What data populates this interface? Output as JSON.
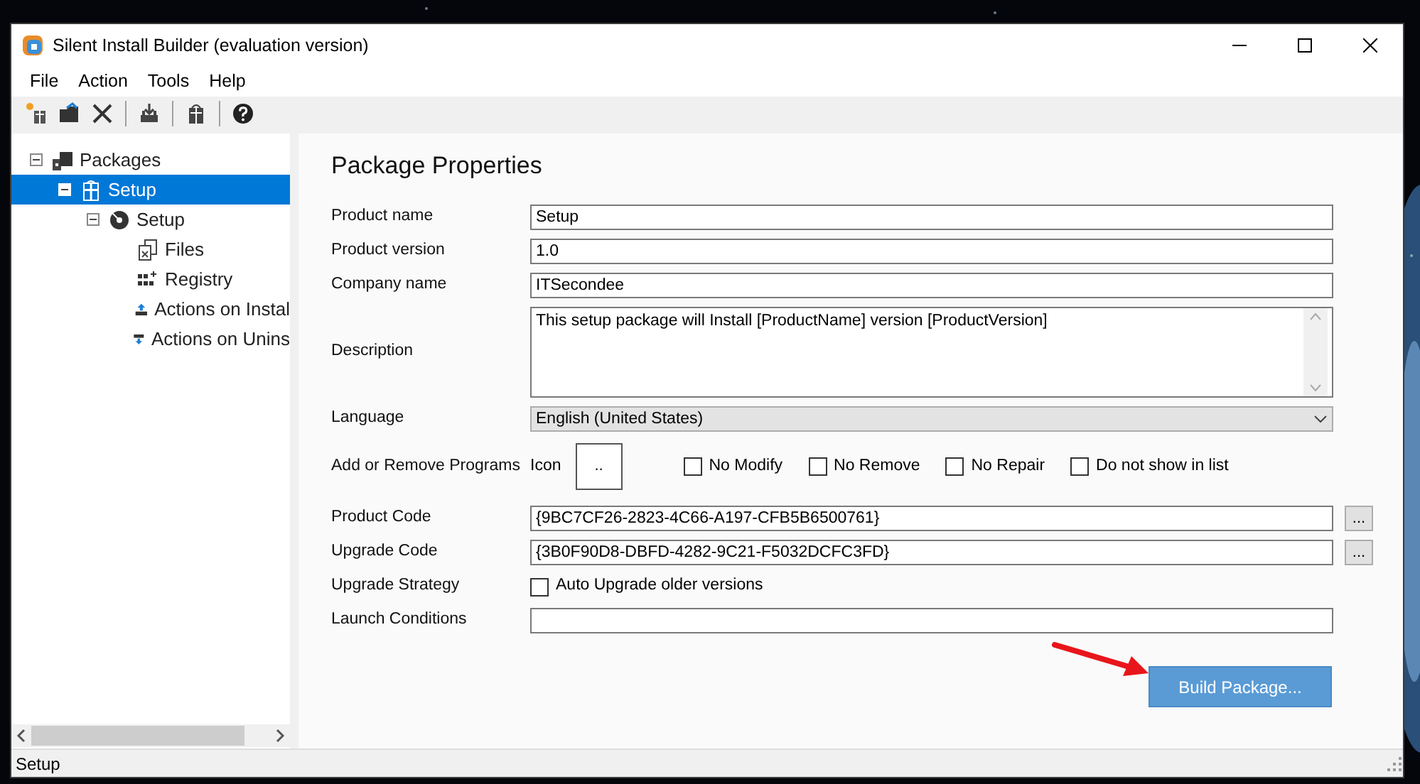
{
  "window": {
    "title": "Silent Install Builder (evaluation version)"
  },
  "menu": [
    "File",
    "Action",
    "Tools",
    "Help"
  ],
  "toolbar": [
    {
      "kind": "new"
    },
    {
      "kind": "open"
    },
    {
      "kind": "delete"
    },
    {
      "kind": "separator"
    },
    {
      "kind": "build"
    },
    {
      "kind": "separator"
    },
    {
      "kind": "package"
    },
    {
      "kind": "separator"
    },
    {
      "kind": "help"
    }
  ],
  "tree": [
    {
      "label": "Packages",
      "kind": "packages",
      "expanded": true,
      "selected": false,
      "children": [
        {
          "label": "Setup",
          "kind": "package",
          "expanded": true,
          "selected": true,
          "children": [
            {
              "label": "Setup",
              "kind": "setup",
              "expanded": true,
              "selected": false,
              "children": [
                {
                  "label": "Files",
                  "kind": "files",
                  "selected": false
                },
                {
                  "label": "Registry",
                  "kind": "registry",
                  "selected": false
                },
                {
                  "label": "Actions on Instal",
                  "kind": "install",
                  "selected": false
                },
                {
                  "label": "Actions on Unins",
                  "kind": "uninstall",
                  "selected": false
                }
              ]
            }
          ]
        }
      ]
    }
  ],
  "form": {
    "title": "Package Properties",
    "fields": [
      {
        "kind": "text",
        "label": "Product name",
        "value": "Setup"
      },
      {
        "kind": "text",
        "label": "Product version",
        "value": "1.0"
      },
      {
        "kind": "text",
        "label": "Company name",
        "value": "ITSecondee"
      },
      {
        "kind": "textarea",
        "label": "Description",
        "value": "This setup package will Install [ProductName] version [ProductVersion]"
      },
      {
        "kind": "select",
        "label": "Language",
        "value": "English (United States)"
      },
      {
        "kind": "arp",
        "label": "Add or Remove Programs",
        "icon_label": "Icon",
        "icon_button": "..",
        "options": [
          {
            "label": "No Modify",
            "checked": false
          },
          {
            "label": "No Remove",
            "checked": false
          },
          {
            "label": "No Repair",
            "checked": false
          },
          {
            "label": "Do not show in list",
            "checked": false
          }
        ]
      },
      {
        "kind": "code",
        "label": "Product Code",
        "value": "{9BC7CF26-2823-4C66-A197-CFB5B6500761}",
        "button": "..."
      },
      {
        "kind": "code",
        "label": "Upgrade Code",
        "value": "{3B0F90D8-DBFD-4282-9C21-F5032DCFC3FD}",
        "button": "..."
      },
      {
        "kind": "checkbox",
        "label": "Upgrade Strategy",
        "option": {
          "label": "Auto Upgrade older versions",
          "checked": false
        }
      },
      {
        "kind": "text",
        "label": "Launch Conditions"
      }
    ]
  },
  "build_button": "Build Package...",
  "status_bar": "Setup"
}
